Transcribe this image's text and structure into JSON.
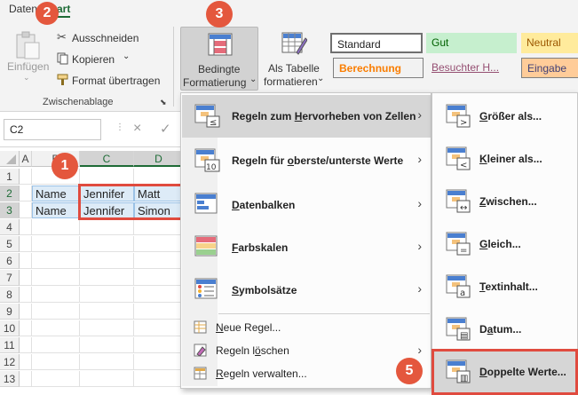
{
  "tabs": {
    "data": "Daten",
    "start": "Start"
  },
  "clipboard": {
    "paste_label": "Einfügen",
    "cut_label": "Ausschneiden",
    "copy_label": "Kopieren",
    "format_label": "Format übertragen",
    "group_name": "Zwischenablage"
  },
  "cf_button": {
    "line1": "Bedingte",
    "line2": "Formatierung"
  },
  "table_button": {
    "line1": "Als Tabelle",
    "line2": "formatieren"
  },
  "styles": {
    "standard": "Standard",
    "gut": "Gut",
    "neutral": "Neutral",
    "berechnung": "Berechnung",
    "besucht": "Besuchter H...",
    "eingabe": "Eingabe"
  },
  "namebox": {
    "value": "C2"
  },
  "formula_icons": {
    "cancel": "×",
    "confirm": "✓"
  },
  "sheet": {
    "col_headers": [
      "A",
      "B",
      "C",
      "D"
    ],
    "row_headers": [
      "1",
      "2",
      "3",
      "4",
      "5",
      "6",
      "7",
      "8",
      "9",
      "10",
      "11",
      "12",
      "13"
    ],
    "rows": [
      {
        "b": "Name",
        "c": "Jennifer",
        "d": "Matt"
      },
      {
        "b": "Name",
        "c": "Jennifer",
        "d": "Simon"
      }
    ]
  },
  "menu": {
    "items": [
      {
        "label_pre": "Regeln zum ",
        "label_u": "H",
        "label_post": "ervorheben von Zellen",
        "arrow": "›"
      },
      {
        "label_pre": "Regeln für ",
        "label_u": "o",
        "label_post": "berste/unterste Werte",
        "arrow": "›"
      },
      {
        "label_pre": "",
        "label_u": "D",
        "label_post": "atenbalken",
        "arrow": "›"
      },
      {
        "label_pre": "",
        "label_u": "F",
        "label_post": "arbskalen",
        "arrow": "›"
      },
      {
        "label_pre": "",
        "label_u": "S",
        "label_post": "ymbolsätze",
        "arrow": "›"
      }
    ],
    "small_items": [
      {
        "label_pre": "",
        "label_u": "N",
        "label_post": "eue Regel...",
        "arrow": ""
      },
      {
        "label_pre": "Regeln l",
        "label_u": "ö",
        "label_post": "schen",
        "arrow": "›"
      },
      {
        "label_pre": "",
        "label_u": "R",
        "label_post": "egeln verwalten...",
        "arrow": ""
      }
    ]
  },
  "submenu": {
    "items": [
      {
        "label_pre": "",
        "label_u": "G",
        "label_post": "rößer als..."
      },
      {
        "label_pre": "",
        "label_u": "K",
        "label_post": "leiner als..."
      },
      {
        "label_pre": "",
        "label_u": "Z",
        "label_post": "wischen..."
      },
      {
        "label_pre": "",
        "label_u": "G",
        "label_post": "leich..."
      },
      {
        "label_pre": "",
        "label_u": "T",
        "label_post": "extinhalt..."
      },
      {
        "label_pre": "D",
        "label_u": "a",
        "label_post": "tum..."
      },
      {
        "label_pre": "",
        "label_u": "D",
        "label_post": "oppelte Werte..."
      }
    ]
  },
  "badges": {
    "b1": "1",
    "b2": "2",
    "b3": "3",
    "b5": "5"
  },
  "colors": {
    "accent_green": "#1e6b36",
    "badge_red": "#e4573d",
    "highlight_red": "#e04b3f",
    "cell_blue": "#ddebf7",
    "menu_hover": "#d6d6d6"
  }
}
